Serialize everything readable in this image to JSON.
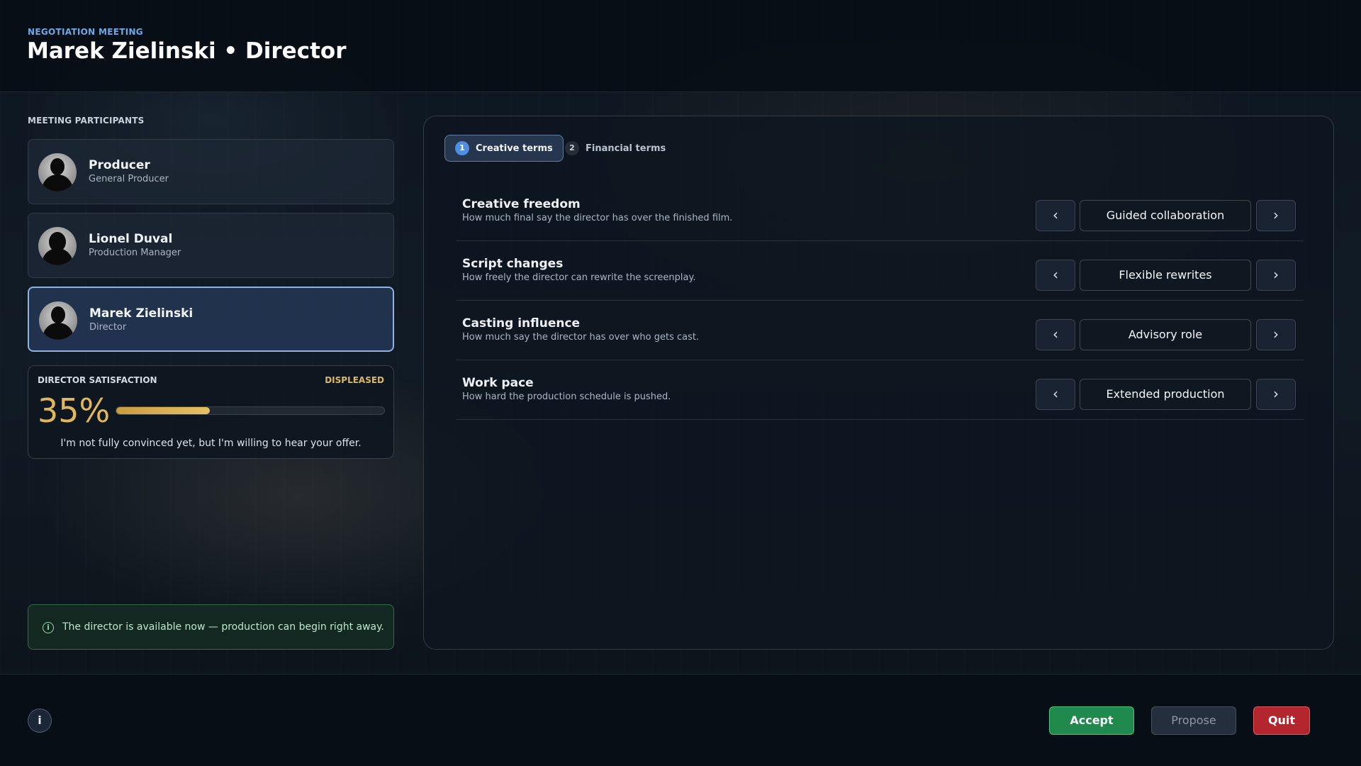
{
  "header": {
    "eyebrow": "NEGOTIATION MEETING",
    "title": "Marek Zielinski • Director"
  },
  "participants": {
    "section_label": "MEETING PARTICIPANTS",
    "items": [
      {
        "name": "Producer",
        "role": "General Producer",
        "active": false
      },
      {
        "name": "Lionel Duval",
        "role": "Production Manager",
        "active": false
      },
      {
        "name": "Marek Zielinski",
        "role": "Director",
        "active": true
      }
    ]
  },
  "satisfaction": {
    "label": "DIRECTOR SATISFACTION",
    "status": "DISPLEASED",
    "percent_text": "35%",
    "value": 0.35,
    "quote": "I'm not fully convinced yet, but I'm willing to hear your offer.",
    "bar_color": "#e0b85a"
  },
  "notice": {
    "icon": "info-circle-icon",
    "text": "The director is available now — production can begin right away."
  },
  "tabs": [
    {
      "number": "1",
      "label": "Creative terms",
      "active": true
    },
    {
      "number": "2",
      "label": "Financial terms",
      "active": false
    }
  ],
  "terms": [
    {
      "title": "Creative freedom",
      "description": "How much final say the director has over the finished film.",
      "value": "Guided collaboration"
    },
    {
      "title": "Script changes",
      "description": "How freely the director can rewrite the screenplay.",
      "value": "Flexible rewrites"
    },
    {
      "title": "Casting influence",
      "description": "How much say the director has over who gets cast.",
      "value": "Advisory role"
    },
    {
      "title": "Work pace",
      "description": "How hard the production schedule is pushed.",
      "value": "Extended production"
    }
  ],
  "arrows": {
    "left": "‹",
    "right": "›"
  },
  "footer": {
    "info_icon": "i",
    "accept_label": "Accept",
    "propose_label": "Propose",
    "quit_label": "Quit"
  },
  "colors": {
    "accent": "#4d8fe0",
    "accept": "#1f8a4c",
    "quit": "#b3262d",
    "satisfaction": "#e0b85a"
  }
}
